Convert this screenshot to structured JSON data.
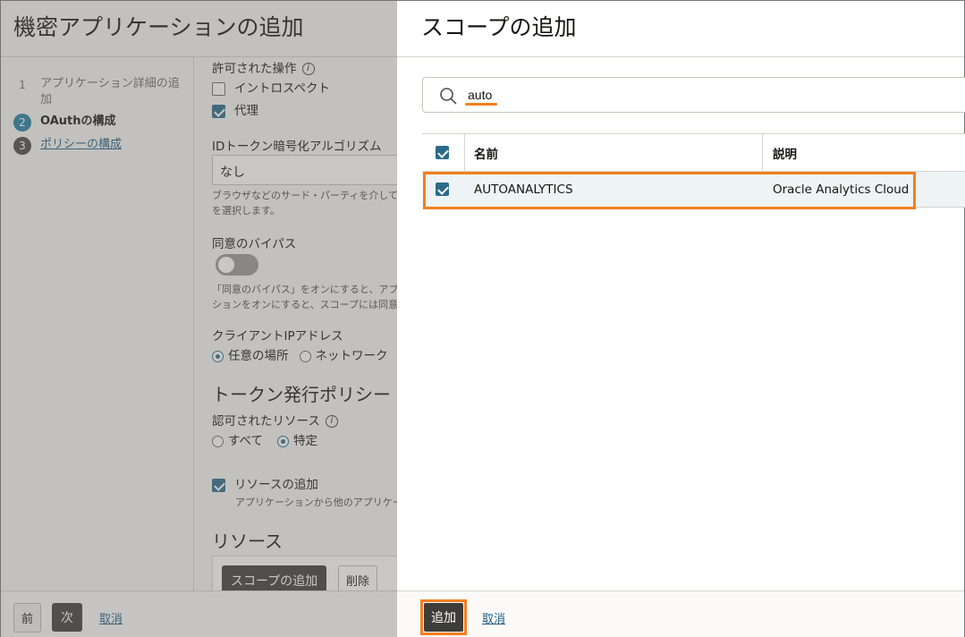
{
  "background": {
    "title": "機密アプリケーションの追加",
    "steps": [
      {
        "num": "1",
        "label": "アプリケーション詳細の追加"
      },
      {
        "num": "2",
        "label": "OAuthの構成"
      },
      {
        "num": "3",
        "label": "ポリシーの構成"
      }
    ],
    "allowed_ops_label": "許可された操作",
    "introspect_label": "イントロスペクト",
    "proxy_label": "代理",
    "id_token_label": "IDトークン暗号化アルゴリズム",
    "id_token_value": "なし",
    "id_token_helper_1": "ブラウザなどのサード・パーティを介して",
    "id_token_helper_2": "を選択します。",
    "consent_bypass_label": "同意のバイパス",
    "consent_helper_1": "「同意のバイパス」をオンにすると、アプ",
    "consent_helper_2": "ションをオンにすると、スコープには同意",
    "client_ip_label": "クライアントIPアドレス",
    "ip_any": "任意の場所",
    "ip_network": "ネットワーク",
    "token_policy_heading": "トークン発行ポリシー",
    "authorized_resources_label": "認可されたリソース",
    "res_all": "すべて",
    "res_specific": "特定",
    "add_resources_label": "リソースの追加",
    "add_resources_helper": "アプリケーションから他のアプリケー",
    "resources_heading": "リソース",
    "add_scope_button": "スコープの追加",
    "delete_button": "削除",
    "footer": {
      "prev": "前",
      "next": "次",
      "cancel": "取消"
    }
  },
  "drawer": {
    "title": "スコープの追加",
    "search": {
      "value": "auto"
    },
    "table": {
      "headers": {
        "name": "名前",
        "description": "説明"
      },
      "rows": [
        {
          "name": "AUTOANALYTICS",
          "description": "Oracle Analytics Cloud",
          "checked": true
        }
      ]
    },
    "footer": {
      "add": "追加",
      "cancel": "取消"
    }
  },
  "colors": {
    "accent": "#f47f20",
    "primary": "#227e9e",
    "checkbox": "#2a6b8a"
  }
}
